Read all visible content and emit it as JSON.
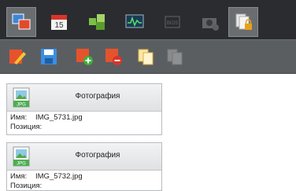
{
  "top_tabs": [
    {
      "name": "gallery-icon"
    },
    {
      "name": "calendar-icon",
      "day": "15"
    },
    {
      "name": "cubes-icon"
    },
    {
      "name": "monitor-graph-icon"
    },
    {
      "name": "bios-chip-icon",
      "text": "BIOS"
    },
    {
      "name": "camera-icon"
    },
    {
      "name": "locked-pages-icon"
    }
  ],
  "colors": {
    "topbar": "#2a2c2f",
    "toolbar": "#5b5e61"
  },
  "cards": [
    {
      "badge": "JPG",
      "title": "Фотография",
      "name_label": "Имя:",
      "name_value": "IMG_5731.jpg",
      "position_label": "Позиция:"
    },
    {
      "badge": "JPG",
      "title": "Фотография",
      "name_label": "Имя:",
      "name_value": "IMG_5732.jpg",
      "position_label": "Позиция:"
    }
  ]
}
